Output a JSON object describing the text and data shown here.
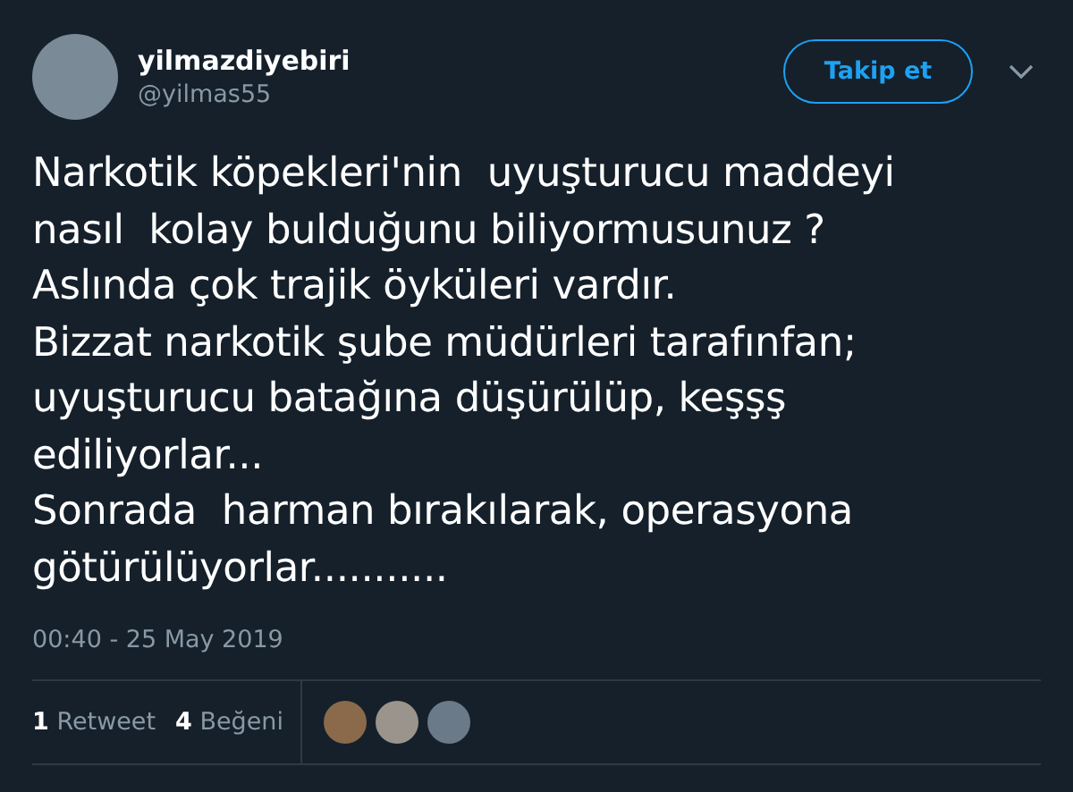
{
  "author": {
    "name": "yilmazdiyebiri",
    "handle": "@yilmas55"
  },
  "follow_button": {
    "label": "Takip et"
  },
  "tweet_lines": [
    "Narkotik köpekleri'nin  uyuşturucu maddeyi",
    "nasıl  kolay bulduğunu biliyormusunuz ?",
    "Aslında çok trajik öyküleri vardır.",
    "Bizzat narkotik şube müdürleri tarafınfan;",
    "uyuşturucu batağına düşürülüp, keşşş",
    "ediliyorlar...",
    "Sonrada  harman bırakılarak, operasyona",
    "götürülüyorlar..........."
  ],
  "timestamp": "00:40 - 25 May 2019",
  "stats": [
    {
      "count": "1",
      "label": "Retweet"
    },
    {
      "count": "4",
      "label": "Beğeni"
    }
  ],
  "liker_avatars": [
    {
      "color": "#8a6a4a"
    },
    {
      "color": "#9a948c"
    },
    {
      "color": "#6a7a88"
    }
  ]
}
